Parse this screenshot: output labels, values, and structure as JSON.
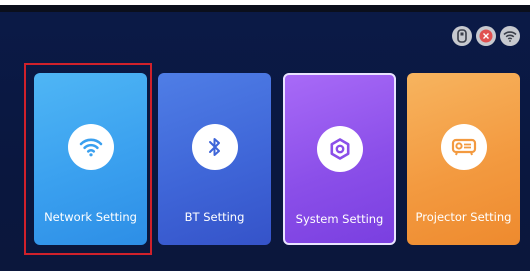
{
  "status_bar": {
    "icons": [
      "usb-drive-icon",
      "bluetooth-off-icon",
      "wifi-icon"
    ]
  },
  "cards": [
    {
      "id": "network",
      "label": "Network Setting",
      "icon": "wifi-icon",
      "color": "#3aa0ef",
      "selected": true
    },
    {
      "id": "bt",
      "label": "BT Setting",
      "icon": "bluetooth-icon",
      "color": "#3f66d8",
      "selected": false
    },
    {
      "id": "system",
      "label": "System Setting",
      "icon": "settings-hex-icon",
      "color": "#8b4fe9",
      "selected": false
    },
    {
      "id": "projector",
      "label": "Projector Setting",
      "icon": "projector-icon",
      "color": "#f39a40",
      "selected": false
    }
  ],
  "colors": {
    "background": "#0a173f",
    "focus_ring": "#d0212b",
    "status_badge": "#e05050"
  }
}
